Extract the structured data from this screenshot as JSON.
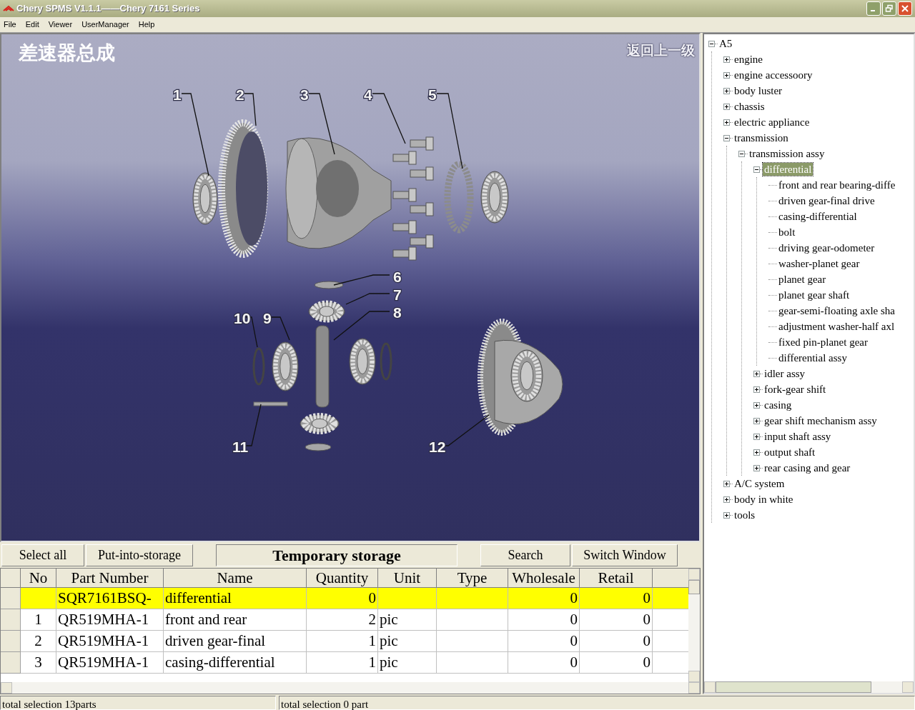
{
  "window": {
    "title": "Chery SPMS V1.1.1——Chery 7161 Series"
  },
  "menu": [
    "File",
    "Edit",
    "Viewer",
    "UserManager",
    "Help"
  ],
  "diagram": {
    "title": "差速器总成",
    "back_link": "返回上一级",
    "callouts": [
      "1",
      "2",
      "3",
      "4",
      "5",
      "6",
      "7",
      "8",
      "10",
      "9",
      "11",
      "12"
    ]
  },
  "toolbar": {
    "left_buttons": [
      "Select all",
      "Put-into-storage"
    ],
    "panel_label": "Temporary storage",
    "right_buttons": [
      "Search",
      "Switch Window"
    ]
  },
  "table": {
    "columns": [
      "No",
      "Part Number",
      "Name",
      "Quantity",
      "Unit",
      "Type",
      "Wholesale",
      "Retail"
    ],
    "rows": [
      {
        "no": "",
        "part_number": "SQR7161BSQ-",
        "name": "differential",
        "quantity": "0",
        "unit": "",
        "type": "",
        "wholesale": "0",
        "retail": "0",
        "selected": true
      },
      {
        "no": "1",
        "part_number": "QR519MHA-1",
        "name": "front and rear",
        "quantity": "2",
        "unit": "pic",
        "type": "",
        "wholesale": "0",
        "retail": "0",
        "selected": false
      },
      {
        "no": "2",
        "part_number": "QR519MHA-1",
        "name": "driven gear-final",
        "quantity": "1",
        "unit": "pic",
        "type": "",
        "wholesale": "0",
        "retail": "0",
        "selected": false
      },
      {
        "no": "3",
        "part_number": "QR519MHA-1",
        "name": "casing-differential",
        "quantity": "1",
        "unit": "pic",
        "type": "",
        "wholesale": "0",
        "retail": "0",
        "selected": false
      }
    ]
  },
  "tree": [
    {
      "label": "A5",
      "kind": "branch",
      "expanded": true,
      "selected": false,
      "children": [
        {
          "label": "engine",
          "kind": "branch",
          "expanded": false,
          "selected": false
        },
        {
          "label": "engine accessoory",
          "kind": "branch",
          "expanded": false,
          "selected": false
        },
        {
          "label": "body luster",
          "kind": "branch",
          "expanded": false,
          "selected": false
        },
        {
          "label": "chassis",
          "kind": "branch",
          "expanded": false,
          "selected": false
        },
        {
          "label": "electric appliance",
          "kind": "branch",
          "expanded": false,
          "selected": false
        },
        {
          "label": "transmission",
          "kind": "branch",
          "expanded": true,
          "selected": false,
          "children": [
            {
              "label": "transmission assy",
              "kind": "branch",
              "expanded": true,
              "selected": false,
              "children": [
                {
                  "label": "differential",
                  "kind": "branch",
                  "expanded": true,
                  "selected": true,
                  "children": [
                    {
                      "label": "front and rear bearing-diffe",
                      "kind": "leaf",
                      "selected": false
                    },
                    {
                      "label": "driven gear-final drive",
                      "kind": "leaf",
                      "selected": false
                    },
                    {
                      "label": "casing-differential",
                      "kind": "leaf",
                      "selected": false
                    },
                    {
                      "label": "bolt",
                      "kind": "leaf",
                      "selected": false
                    },
                    {
                      "label": "driving gear-odometer",
                      "kind": "leaf",
                      "selected": false
                    },
                    {
                      "label": "washer-planet gear",
                      "kind": "leaf",
                      "selected": false
                    },
                    {
                      "label": "planet gear",
                      "kind": "leaf",
                      "selected": false
                    },
                    {
                      "label": "planet gear shaft",
                      "kind": "leaf",
                      "selected": false
                    },
                    {
                      "label": "gear-semi-floating axle sha",
                      "kind": "leaf",
                      "selected": false
                    },
                    {
                      "label": "adjustment washer-half axl",
                      "kind": "leaf",
                      "selected": false
                    },
                    {
                      "label": "fixed pin-planet gear",
                      "kind": "leaf",
                      "selected": false
                    },
                    {
                      "label": "differential assy",
                      "kind": "leaf",
                      "selected": false
                    }
                  ]
                },
                {
                  "label": "idler assy",
                  "kind": "branch",
                  "expanded": false,
                  "selected": false
                },
                {
                  "label": "fork-gear shift",
                  "kind": "branch",
                  "expanded": false,
                  "selected": false
                },
                {
                  "label": "casing",
                  "kind": "branch",
                  "expanded": false,
                  "selected": false
                },
                {
                  "label": "gear shift mechanism assy",
                  "kind": "branch",
                  "expanded": false,
                  "selected": false
                },
                {
                  "label": "input shaft assy",
                  "kind": "branch",
                  "expanded": false,
                  "selected": false
                },
                {
                  "label": "output shaft",
                  "kind": "branch",
                  "expanded": false,
                  "selected": false
                },
                {
                  "label": "rear casing and gear",
                  "kind": "branch",
                  "expanded": false,
                  "selected": false
                }
              ]
            }
          ]
        },
        {
          "label": "A/C system",
          "kind": "branch",
          "expanded": false,
          "selected": false
        },
        {
          "label": "body in white",
          "kind": "branch",
          "expanded": false,
          "selected": false
        },
        {
          "label": "tools",
          "kind": "branch",
          "expanded": false,
          "selected": false
        }
      ]
    }
  ],
  "status_bar": [
    "total selection 13parts",
    "total selection 0 part"
  ]
}
